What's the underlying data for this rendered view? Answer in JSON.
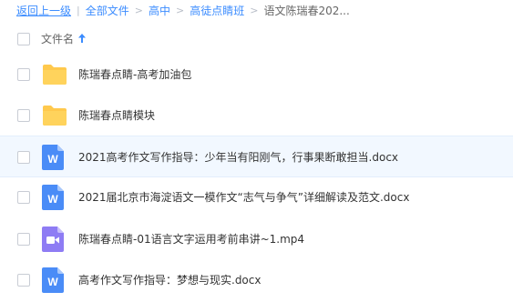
{
  "breadcrumb": {
    "back_label": "返回上一级",
    "items": [
      "全部文件",
      "高中",
      "高徒点睛班"
    ],
    "current": "语文陈瑞春202..."
  },
  "list_header": {
    "name_label": "文件名",
    "sort_icon": "arrow-up-icon"
  },
  "files": [
    {
      "name": "陈瑞春点睛-高考加油包",
      "type": "folder",
      "icon": "folder-icon"
    },
    {
      "name": "陈瑞春点睛模块",
      "type": "folder",
      "icon": "folder-icon"
    },
    {
      "name": "2021高考作文写作指导：少年当有阳刚气，行事果断敢担当.docx",
      "type": "docx",
      "icon": "word-doc-icon",
      "hovered": true
    },
    {
      "name": "2021届北京市海淀语文一模作文“志气与争气”详细解读及范文.docx",
      "type": "docx",
      "icon": "word-doc-icon"
    },
    {
      "name": "陈瑞春点睛-01语言文字运用考前串讲~1.mp4",
      "type": "mp4",
      "icon": "video-file-icon"
    },
    {
      "name": "高考作文写作指导：梦想与现实.docx",
      "type": "docx",
      "icon": "word-doc-icon"
    }
  ],
  "colors": {
    "link": "#3b8cff",
    "folder": "#ffc94d",
    "word": "#4a8cf7",
    "video": "#8e7cf4",
    "hover_row": "#f2f8ff"
  }
}
